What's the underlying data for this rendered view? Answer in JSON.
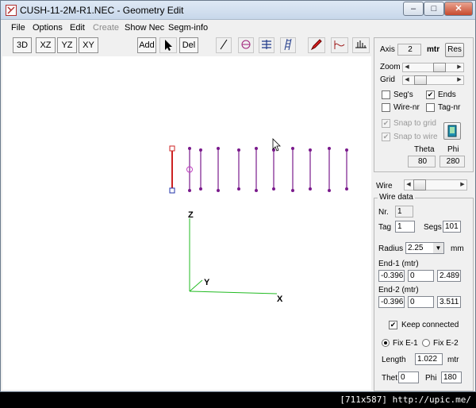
{
  "window": {
    "title": "CUSH-11-2M-R1.NEC - Geometry Edit",
    "minimize": "–",
    "maximize": "□",
    "close": "✕"
  },
  "menu": [
    "File",
    "Options",
    "Edit",
    "Create",
    "Show Nec",
    "Segm-info"
  ],
  "menu_disabled": [
    false,
    false,
    false,
    true,
    false,
    false
  ],
  "toolbar": {
    "view_3d": "3D",
    "view_xz": "XZ",
    "view_yz": "YZ",
    "view_xy": "XY",
    "add": "Add",
    "del": "Del"
  },
  "toolbar_icons": [
    "pointer-icon",
    "draw-wire-icon",
    "helix-icon",
    "stack-icon",
    "ladder-icon",
    "pencil-icon",
    "waveform-icon",
    "ground-icon"
  ],
  "canvas": {
    "axes": {
      "z": "Z",
      "y": "Y",
      "x": "X"
    },
    "wire_count": 11,
    "selected_wire_color": "#cc2222",
    "wire_color": "#7a1a8c",
    "axis_color": "#22bb22"
  },
  "panel": {
    "axis_label": "Axis",
    "axis_value": "2",
    "axis_unit": "mtr",
    "reset": "Res",
    "zoom_label": "Zoom",
    "zoom_level": 0.6,
    "grid_label": "Grid",
    "grid_level": 0.2,
    "segs_label": "Seg's",
    "segs_checked": false,
    "ends_label": "Ends",
    "ends_checked": true,
    "wire_nr_label": "Wire-nr",
    "wire_nr_checked": false,
    "tag_nr_label": "Tag-nr",
    "tag_nr_checked": false,
    "snap_grid_label": "Snap to grid",
    "snap_grid_checked": true,
    "snap_wire_label": "Snap to wire",
    "snap_wire_checked": true,
    "theta_label": "Theta",
    "phi_label": "Phi",
    "theta_value": "80",
    "phi_value": "280",
    "wire_label": "Wire",
    "wire_data_label": "Wire data",
    "nr_label": "Nr.",
    "nr_value": "1",
    "tag_label": "Tag",
    "tag_value": "1",
    "segs_field_label": "Segs",
    "segs_value": "101",
    "radius_label": "Radius",
    "radius_value": "2.25",
    "radius_unit": "mm",
    "end1_label": "End-1 (mtr)",
    "end1": [
      "-0.396",
      "0",
      "2.489"
    ],
    "end2_label": "End-2 (mtr)",
    "end2": [
      "-0.396",
      "0",
      "3.511"
    ],
    "keep_connected_label": "Keep connected",
    "keep_connected_checked": true,
    "fix_e1_label": "Fix E-1",
    "fix_e2_label": "Fix E-2",
    "fix_selected": "e1",
    "length_label": "Length",
    "length_value": "1.022",
    "length_unit": "mtr",
    "theta_short_label": "Thet",
    "theta_short_value": "0",
    "phi_short_label": "Phi",
    "phi_short_value": "180"
  },
  "statusbar": "[711x587] http://upic.me/"
}
